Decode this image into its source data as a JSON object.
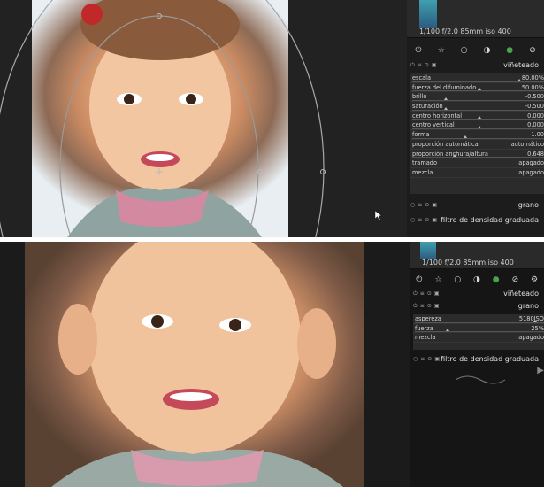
{
  "top": {
    "histogram_info": "1/100 f/2.0 85mm iso 400",
    "icons": [
      "power-icon",
      "star-icon",
      "circle-icon",
      "half-circle-icon",
      "color-circle-icon",
      "swirl-icon"
    ],
    "module_title": "viñeteado",
    "params": [
      {
        "label": "escala",
        "value": "80.00%",
        "level": 0.8
      },
      {
        "label": "fuerza del difuminado",
        "value": "50.00%",
        "level": 0.5
      },
      {
        "label": "brillo",
        "value": "-0.500",
        "level": 0.25
      },
      {
        "label": "saturación",
        "value": "-0.500",
        "level": 0.25
      },
      {
        "label": "centro horizontal",
        "value": "0.000",
        "level": 0.5
      },
      {
        "label": "centro vertical",
        "value": "0.000",
        "level": 0.5
      },
      {
        "label": "forma",
        "value": "1.00",
        "level": 0.4
      },
      {
        "label": "proporción automática",
        "value": "automático",
        "level": null
      },
      {
        "label": "proporción anchura/altura",
        "value": "0.648",
        "level": 0.32
      },
      {
        "label": "tramado",
        "value": "apagado",
        "level": null
      },
      {
        "label": "mezcla",
        "value": "apagado",
        "level": null
      }
    ],
    "module_grano": "grano",
    "module_filter": "filtro de densidad graduada"
  },
  "bottom": {
    "histogram_info": "1/100 f/2.0 85mm iso 400",
    "icons": [
      "power-icon",
      "star-icon",
      "circle-icon",
      "half-circle-icon",
      "color-circle-icon",
      "swirl-icon",
      "gear-icon"
    ],
    "module_vignette": "viñeteado",
    "module_title": "grano",
    "params": [
      {
        "label": "aspereza",
        "value": "5180ISO",
        "level": 0.92
      },
      {
        "label": "fuerza",
        "value": "25%",
        "level": 0.25
      },
      {
        "label": "mezcla",
        "value": "apagado",
        "level": null
      }
    ],
    "module_filter": "filtro de densidad graduada"
  },
  "colors": {
    "accent": "#4aa347",
    "panel": "#1c1c1c",
    "row": "#2b2b2b"
  }
}
